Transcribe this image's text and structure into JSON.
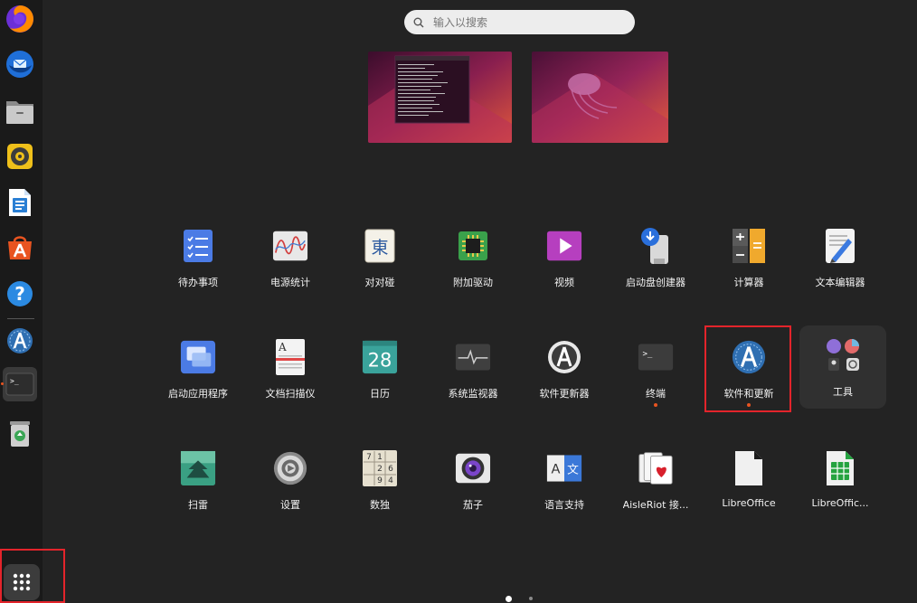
{
  "search": {
    "placeholder": "输入以搜索"
  },
  "dock": {
    "items": [
      "firefox-icon",
      "thunderbird-icon",
      "files-icon",
      "rhythmbox-icon",
      "writer-icon",
      "app-center-icon",
      "help-icon",
      "software-updater-icon",
      "terminal-icon",
      "trash-icon"
    ],
    "show_apps": "show-apps-icon"
  },
  "calendar_day": "28",
  "apps": [
    {
      "label": "待办事项"
    },
    {
      "label": "电源统计"
    },
    {
      "label": "对对碰",
      "glyph": "東"
    },
    {
      "label": "附加驱动"
    },
    {
      "label": "视频"
    },
    {
      "label": "启动盘创建器"
    },
    {
      "label": "计算器"
    },
    {
      "label": "文本编辑器"
    },
    {
      "label": "启动应用程序"
    },
    {
      "label": "文档扫描仪"
    },
    {
      "label": "日历"
    },
    {
      "label": "系统监视器"
    },
    {
      "label": "软件更新器"
    },
    {
      "label": "终端"
    },
    {
      "label": "软件和更新"
    },
    {
      "label": "工具"
    },
    {
      "label": "扫雷"
    },
    {
      "label": "设置"
    },
    {
      "label": "数独"
    },
    {
      "label": "茄子"
    },
    {
      "label": "语言支持",
      "glyph_a": "A",
      "glyph_b": "文"
    },
    {
      "label": "AisleRiot 接..."
    },
    {
      "label": "LibreOffice"
    },
    {
      "label": "LibreOffic..."
    }
  ],
  "sudoku_digits": [
    "7",
    "1",
    "2",
    "6",
    "9",
    "4"
  ],
  "colors": {
    "accent": "#e95420",
    "highlight": "#e3242b"
  }
}
